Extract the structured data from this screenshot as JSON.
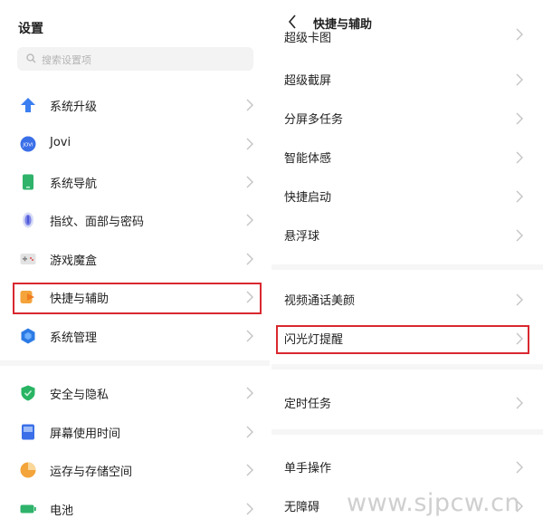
{
  "left": {
    "title": "设置",
    "search_placeholder": "搜索设置项",
    "items": [
      {
        "label": "系统升级",
        "icon": "system-update-icon"
      },
      {
        "label": "Jovi",
        "icon": "jovi-icon",
        "icon_text": "JOVI"
      },
      {
        "label": "系统导航",
        "icon": "system-navigation-icon"
      },
      {
        "label": "指纹、面部与密码",
        "icon": "fingerprint-icon"
      },
      {
        "label": "游戏魔盒",
        "icon": "game-box-icon"
      },
      {
        "label": "快捷与辅助",
        "icon": "shortcut-assist-icon",
        "highlighted": true
      },
      {
        "label": "系统管理",
        "icon": "system-management-icon"
      },
      {
        "label": "安全与隐私",
        "icon": "security-privacy-icon"
      },
      {
        "label": "屏幕使用时间",
        "icon": "screen-time-icon"
      },
      {
        "label": "运存与存储空间",
        "icon": "storage-icon"
      },
      {
        "label": "电池",
        "icon": "battery-icon"
      }
    ]
  },
  "right": {
    "header_title": "快捷与辅助",
    "partial_item": "超级卡图",
    "items": [
      {
        "label": "超级截屏"
      },
      {
        "label": "分屏多任务"
      },
      {
        "label": "智能体感"
      },
      {
        "label": "快捷启动"
      },
      {
        "label": "悬浮球"
      },
      {
        "label": "视频通话美颜"
      },
      {
        "label": "闪光灯提醒",
        "highlighted": true
      },
      {
        "label": "定时任务"
      },
      {
        "label": "单手操作"
      },
      {
        "label": "无障碍"
      }
    ]
  },
  "watermark": "www.sjpcw.cn",
  "colors": {
    "highlight_border": "#d9282f",
    "chevron": "#c4c4c4",
    "search_bg": "#f3f3f3"
  }
}
